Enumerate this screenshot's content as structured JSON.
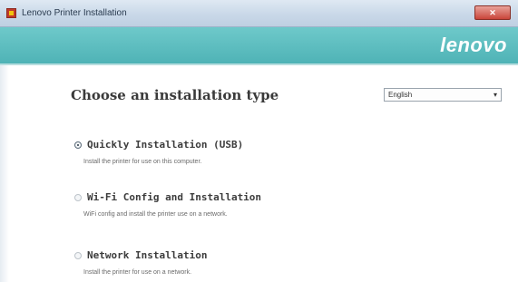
{
  "window": {
    "title": "Lenovo Printer Installation",
    "close_label": "✕"
  },
  "banner": {
    "brand": "lenovo",
    "color": "#5bbdbf"
  },
  "main": {
    "heading": "Choose an installation type",
    "language": {
      "selected": "English"
    },
    "options": [
      {
        "label": "Quickly Installation (USB)",
        "description": "Install the printer for use on this computer.",
        "selected": true
      },
      {
        "label": "Wi-Fi Config and Installation",
        "description": "WiFi config and install the printer use on a network.",
        "selected": false
      },
      {
        "label": "Network Installation",
        "description": "Install the printer for use on a network.",
        "selected": false
      }
    ]
  }
}
